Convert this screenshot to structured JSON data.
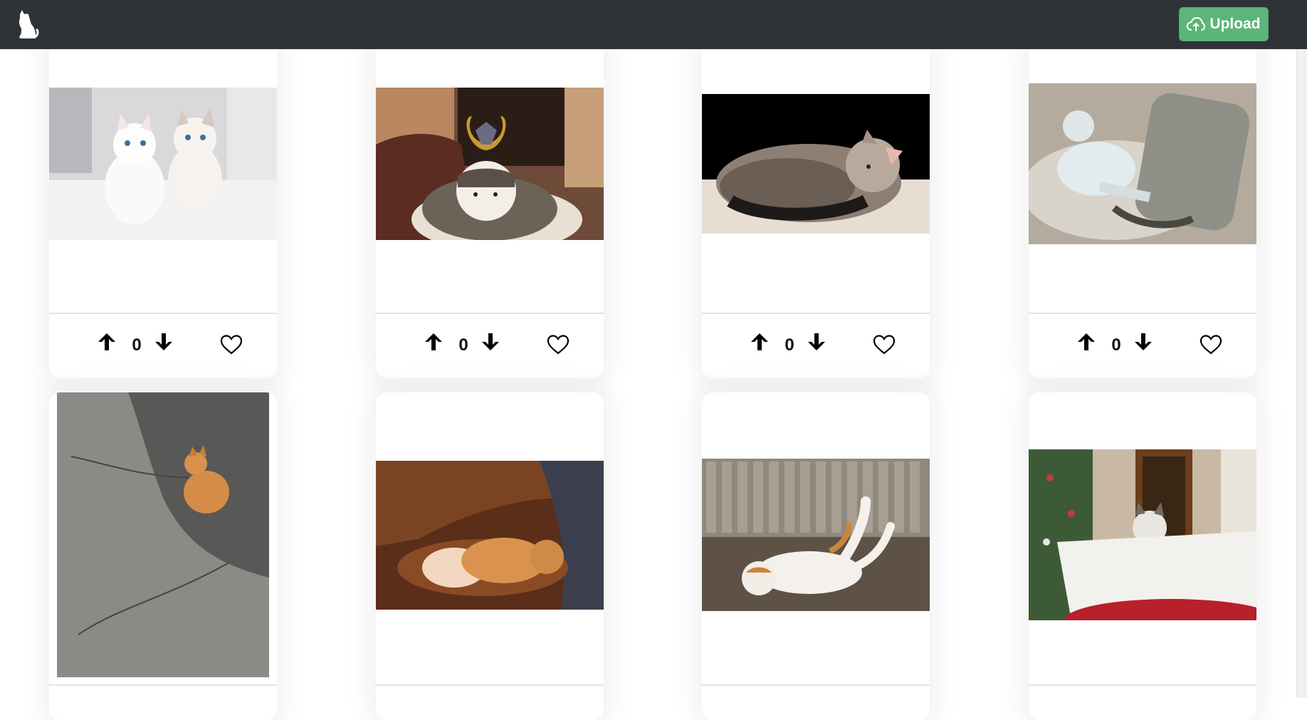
{
  "header": {
    "upload_label": "Upload",
    "logo_icon": "cat-logo-icon",
    "upload_icon": "cloud-upload-icon"
  },
  "colors": {
    "navbar": "#2f3337",
    "upload": "#5cb579",
    "divider": "#e3e3e3"
  },
  "cards": [
    {
      "score": "0",
      "image": "two-white-kittens"
    },
    {
      "score": "0",
      "image": "cat-wearing-samurai-helmet"
    },
    {
      "score": "0",
      "image": "tabby-kitten-curled-up"
    },
    {
      "score": "0",
      "image": "white-cat-hugging-pillow"
    },
    {
      "image": "orange-kitten-on-asphalt"
    },
    {
      "image": "orange-cat-sleeping-on-blanket"
    },
    {
      "image": "calico-cat-rolling-on-ground"
    },
    {
      "image": "cat-sitting-at-table-near-christmas-tree"
    }
  ]
}
